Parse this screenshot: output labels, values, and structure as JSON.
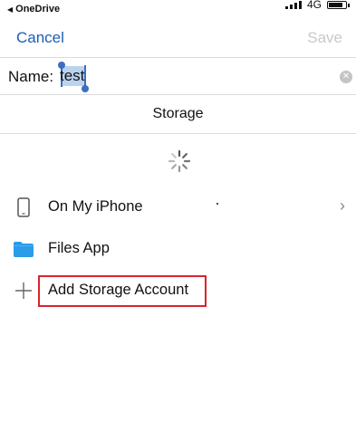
{
  "status_bar": {
    "back_app": "OneDrive",
    "network": "4G"
  },
  "nav": {
    "cancel_label": "Cancel",
    "save_label": "Save"
  },
  "name_field": {
    "label": "Name:",
    "value": "test"
  },
  "storage": {
    "title": "Storage",
    "items": [
      {
        "label": "On My iPhone",
        "icon": "phone-icon",
        "has_chevron": true
      },
      {
        "label": "Files App",
        "icon": "folder-icon",
        "has_chevron": false
      },
      {
        "label": "Add Storage Account",
        "icon": "plus-icon",
        "has_chevron": false,
        "highlighted": true
      }
    ]
  },
  "colors": {
    "accent": "#1a5fb4",
    "disabled": "#c9c9c9",
    "highlight_border": "#d9232d",
    "folder": "#2a9ce8"
  }
}
